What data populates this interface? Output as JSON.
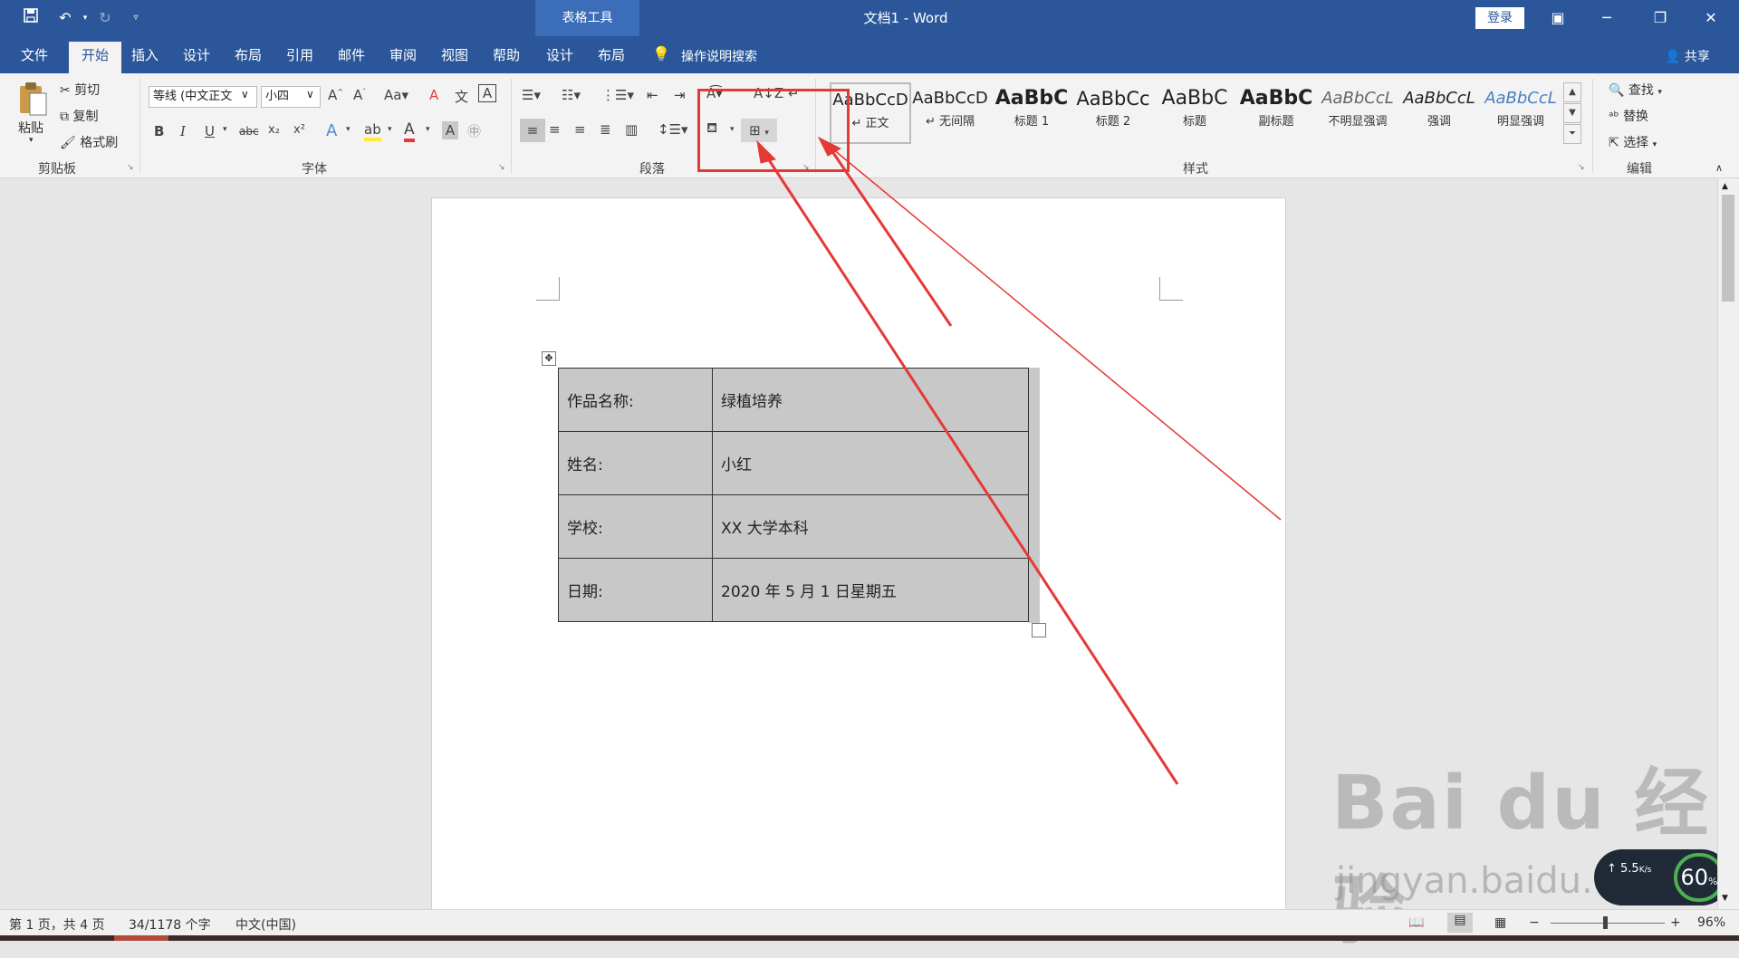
{
  "titlebar": {
    "doc_title": "文档1  -  Word",
    "context_group": "表格工具",
    "login_label": "登录"
  },
  "tabs": [
    {
      "label": "文件"
    },
    {
      "label": "开始"
    },
    {
      "label": "插入"
    },
    {
      "label": "设计"
    },
    {
      "label": "布局"
    },
    {
      "label": "引用"
    },
    {
      "label": "邮件"
    },
    {
      "label": "审阅"
    },
    {
      "label": "视图"
    },
    {
      "label": "帮助"
    },
    {
      "label": "设计"
    },
    {
      "label": "布局"
    }
  ],
  "tell_me": "操作说明搜索",
  "share_label": "共享",
  "clipboard": {
    "paste": "粘贴",
    "cut": "剪切",
    "copy": "复制",
    "format_painter": "格式刷",
    "group_label": "剪贴板"
  },
  "font": {
    "font_name": "等线 (中文正文",
    "font_size": "小四",
    "group_label": "字体"
  },
  "paragraph": {
    "group_label": "段落"
  },
  "styles": {
    "items": [
      {
        "sample": "AaBbCcD",
        "name": "↵ 正文"
      },
      {
        "sample": "AaBbCcD",
        "name": "↵ 无间隔"
      },
      {
        "sample": "AaBbC",
        "name": "标题 1"
      },
      {
        "sample": "AaBbCc",
        "name": "标题 2"
      },
      {
        "sample": "AaBbC",
        "name": "标题"
      },
      {
        "sample": "AaBbC",
        "name": "副标题"
      },
      {
        "sample": "AaBbCcL",
        "name": "不明显强调"
      },
      {
        "sample": "AaBbCcL",
        "name": "强调"
      },
      {
        "sample": "AaBbCcL",
        "name": "明显强调"
      }
    ],
    "group_label": "样式"
  },
  "editing": {
    "find": "查找",
    "replace": "替换",
    "select": "选择",
    "group_label": "编辑"
  },
  "table": {
    "rows": [
      [
        "作品名称:",
        "绿植培养"
      ],
      [
        "姓名:",
        "小红"
      ],
      [
        "学校:",
        "XX 大学本科"
      ],
      [
        "日期:",
        "2020 年 5 月 1 日星期五"
      ]
    ]
  },
  "status": {
    "page": "第 1 页，共 4 页",
    "words": "34/1178 个字",
    "language": "中文(中国)",
    "zoom": "96%"
  },
  "watermark": {
    "logo": "Bai du 经验",
    "url": "jingyan.baidu.com"
  },
  "speed_widget": {
    "upload": "5.5",
    "unit": "K/s",
    "percent": "60",
    "percent_unit": "%"
  },
  "colors": {
    "brand": "#2b579a",
    "annotation": "#e53935",
    "cell_shading": "#c8c8c8"
  }
}
